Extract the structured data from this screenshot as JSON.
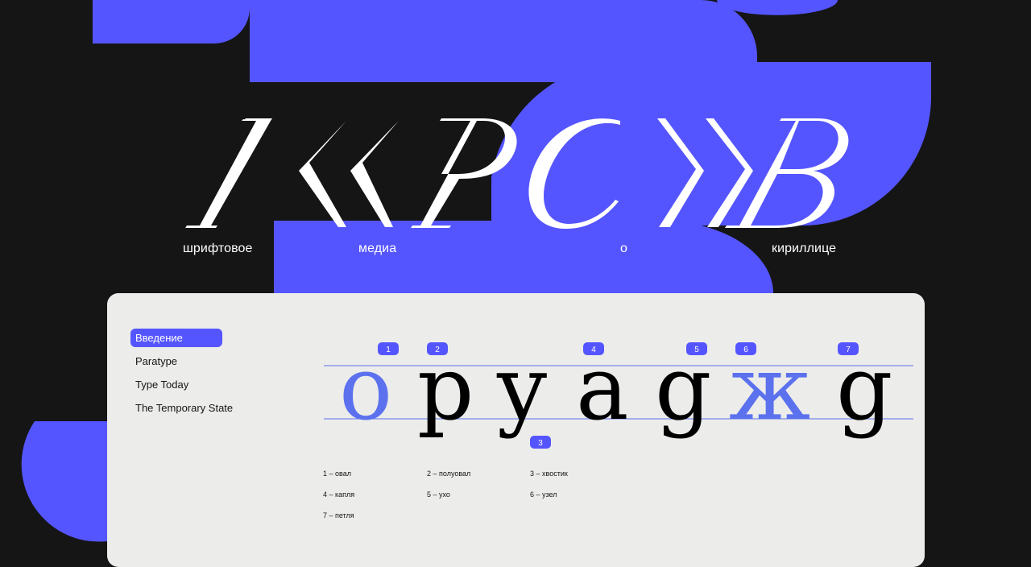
{
  "brand": {
    "logo_text": "КРОСВ",
    "tagline_words": [
      "шрифтовое",
      "медиа",
      "о",
      "кириллице"
    ]
  },
  "colors": {
    "background": "#151515",
    "accent": "#5555ff",
    "card": "#ececea",
    "glyph_light": "#5c71ee",
    "glyph_dark": "#000000",
    "text_white": "#ffffff"
  },
  "nav": {
    "items": [
      {
        "label": "Введение",
        "active": true
      },
      {
        "label": "Paratype",
        "active": false
      },
      {
        "label": "Type Today",
        "active": false
      },
      {
        "label": "The Temporary State",
        "active": false
      }
    ]
  },
  "specimen": {
    "glyphs": [
      "o",
      "p",
      "y",
      "a",
      "g",
      "ж",
      "g"
    ],
    "markers": [
      "1",
      "2",
      "3",
      "4",
      "5",
      "6",
      "7"
    ]
  },
  "legend": [
    {
      "text": "1 – овал"
    },
    {
      "text": "2 – полуовал"
    },
    {
      "text": "3 – хвостик"
    },
    {
      "text": "4 – капля"
    },
    {
      "text": "5 – ухо"
    },
    {
      "text": "6 – узел"
    },
    {
      "text": "7 – петля"
    }
  ]
}
